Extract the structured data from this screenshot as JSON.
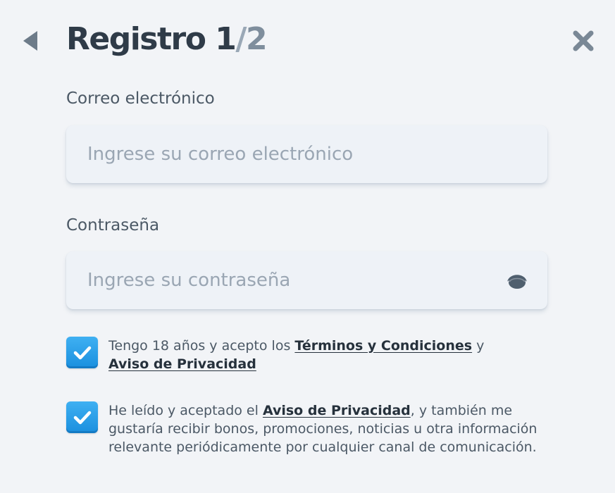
{
  "header": {
    "title_main": "Registro 1",
    "title_sep": "/",
    "title_total": "2",
    "back_icon": "caret-left-icon",
    "close_icon": "close-icon"
  },
  "form": {
    "email": {
      "label": "Correo electrónico",
      "placeholder": "Ingrese su correo electrónico",
      "value": ""
    },
    "password": {
      "label": "Contraseña",
      "placeholder": "Ingrese su contraseña",
      "value": "",
      "toggle_icon": "eye-icon"
    }
  },
  "consents": [
    {
      "checked": true,
      "text_1": "Tengo 18 años y acepto los ",
      "link_1": "Términos y Condiciones",
      "text_2": " y ",
      "link_2": "Aviso de Privacidad",
      "text_3": ""
    },
    {
      "checked": true,
      "text_1": "He leído y aceptado el ",
      "link_1": "Aviso de Privacidad",
      "text_2": ", y también me gustaría recibir bonos, promociones, noticias u otra información relevante periódicamente por cualquier canal de comunicación."
    }
  ],
  "colors": {
    "background": "#f2f4f7",
    "title": "#2f3b48",
    "checkbox": "#1a8fde",
    "placeholder": "#9aa6b3"
  }
}
